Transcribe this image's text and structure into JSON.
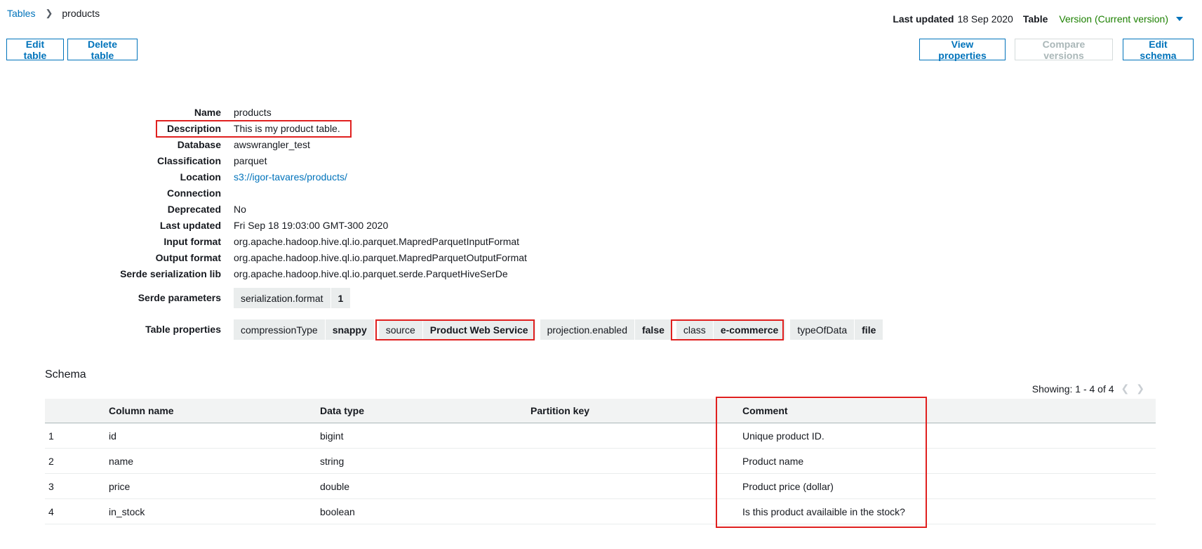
{
  "breadcrumb": {
    "root": "Tables",
    "current": "products"
  },
  "meta": {
    "last_updated_label": "Last updated",
    "last_updated_value": "18 Sep 2020",
    "table_label": "Table",
    "version_label": "Version (Current version)"
  },
  "actions": {
    "edit_table": "Edit table",
    "delete_table": "Delete table",
    "view_properties": "View properties",
    "compare_versions": "Compare versions",
    "edit_schema": "Edit schema"
  },
  "properties": [
    {
      "label": "Name",
      "value": "products"
    },
    {
      "label": "Description",
      "value": "This is my product table."
    },
    {
      "label": "Database",
      "value": "awswrangler_test"
    },
    {
      "label": "Classification",
      "value": "parquet"
    },
    {
      "label": "Location",
      "value": "s3://igor-tavares/products/"
    },
    {
      "label": "Connection",
      "value": ""
    },
    {
      "label": "Deprecated",
      "value": "No"
    },
    {
      "label": "Last updated",
      "value": "Fri Sep 18 19:03:00 GMT-300 2020"
    },
    {
      "label": "Input format",
      "value": "org.apache.hadoop.hive.ql.io.parquet.MapredParquetInputFormat"
    },
    {
      "label": "Output format",
      "value": "org.apache.hadoop.hive.ql.io.parquet.MapredParquetOutputFormat"
    },
    {
      "label": "Serde serialization lib",
      "value": "org.apache.hadoop.hive.ql.io.parquet.serde.ParquetHiveSerDe"
    }
  ],
  "serde_parameters": {
    "label": "Serde parameters",
    "items": [
      {
        "key": "serialization.format",
        "value": "1"
      }
    ]
  },
  "table_properties": {
    "label": "Table properties",
    "items": [
      {
        "key": "compressionType",
        "value": "snappy"
      },
      {
        "key": "source",
        "value": "Product Web Service"
      },
      {
        "key": "projection.enabled",
        "value": "false"
      },
      {
        "key": "class",
        "value": "e-commerce"
      },
      {
        "key": "typeOfData",
        "value": "file"
      }
    ]
  },
  "schema": {
    "title": "Schema",
    "showing": "Showing: 1 - 4 of 4",
    "columns": [
      "",
      "Column name",
      "Data type",
      "Partition key",
      "Comment"
    ],
    "rows": [
      {
        "num": "1",
        "name": "id",
        "type": "bigint",
        "partition": "",
        "comment": "Unique product ID."
      },
      {
        "num": "2",
        "name": "name",
        "type": "string",
        "partition": "",
        "comment": "Product name"
      },
      {
        "num": "3",
        "name": "price",
        "type": "double",
        "partition": "",
        "comment": "Product price (dollar)"
      },
      {
        "num": "4",
        "name": "in_stock",
        "type": "boolean",
        "partition": "",
        "comment": "Is this product availaible in the stock?"
      }
    ]
  },
  "colors": {
    "link": "#0073bb",
    "version": "#1d8102",
    "highlight": "#e0201f",
    "chip_bg": "#eaeded"
  }
}
